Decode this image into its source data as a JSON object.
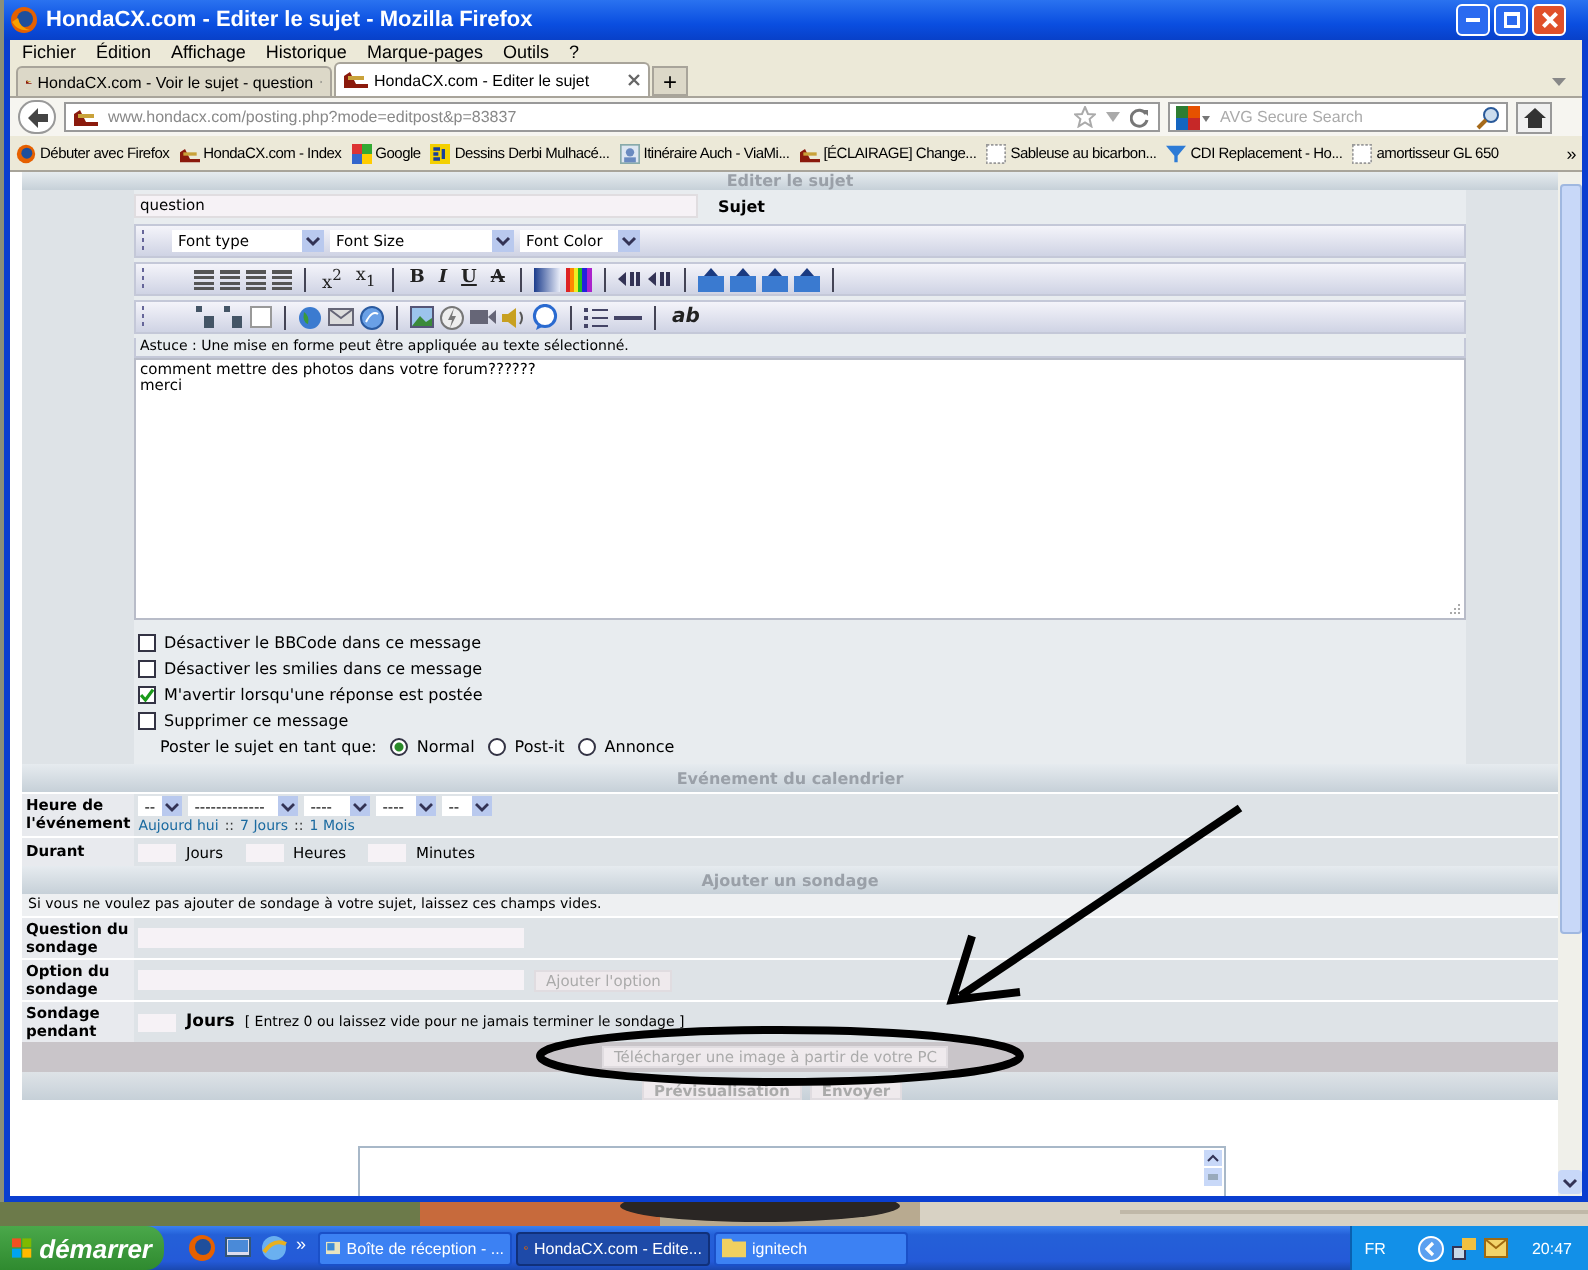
{
  "window": {
    "title": "HondaCX.com - Editer le sujet - Mozilla Firefox"
  },
  "menu": [
    "Fichier",
    "Édition",
    "Affichage",
    "Historique",
    "Marque-pages",
    "Outils",
    "?"
  ],
  "tabs": [
    {
      "label": "HondaCX.com - Voir le sujet - question",
      "selected": false
    },
    {
      "label": "HondaCX.com - Editer le sujet",
      "selected": true
    }
  ],
  "new_tab": "+",
  "address": "www.hondacx.com/posting.php?mode=editpost&p=83837",
  "search": {
    "placeholder": "AVG Secure Search"
  },
  "bookmarks": [
    "Débuter avec Firefox",
    "HondaCX.com - Index",
    "Google",
    "Dessins Derbi Mulhacé...",
    "Itinéraire Auch - ViaMi...",
    "[ÉCLAIRAGE] Change...",
    "Sableuse au bicarbon...",
    "CDI Replacement - Ho...",
    "amortisseur GL 650"
  ],
  "bookmarks_more": "»",
  "page": {
    "header": "Editer le sujet",
    "subject": {
      "value": "question",
      "label": "Sujet"
    },
    "font_selects": [
      "Font type",
      "Font Size",
      "Font Color"
    ],
    "script_buttons": [
      "x$^{2}$",
      "x$_{1}$"
    ],
    "format_buttons": [
      {
        "label": "B",
        "kind": "bold"
      },
      {
        "label": "I",
        "kind": "italic"
      },
      {
        "label": "U",
        "kind": "underline"
      },
      {
        "label": "A",
        "kind": "strike"
      }
    ],
    "spell_button": "ab",
    "hint": "Astuce : Une mise en forme peut être appliquée au texte sélectionné.",
    "message": [
      "comment mettre des photos dans votre forum??????",
      "merci"
    ],
    "options": [
      {
        "label": "Désactiver le BBCode dans ce message",
        "checked": false
      },
      {
        "label": "Désactiver les smilies dans ce message",
        "checked": false
      },
      {
        "label": "M'avertir lorsqu'une réponse est postée",
        "checked": true
      },
      {
        "label": "Supprimer ce message",
        "checked": false
      }
    ],
    "post_type": {
      "label": "Poster le sujet en tant que:",
      "choices": [
        {
          "label": "Normal",
          "selected": true
        },
        {
          "label": "Post-it",
          "selected": false
        },
        {
          "label": "Annonce",
          "selected": false
        }
      ]
    },
    "calendar": {
      "title": "Evénement du calendrier",
      "time_label": "Heure de l'événement",
      "selects": [
        "--",
        "-------------",
        "----",
        "----",
        "--"
      ],
      "shortcuts": [
        {
          "kind": "link",
          "text": "Aujourd hui"
        },
        {
          "kind": "sep",
          "text": "::"
        },
        {
          "kind": "link",
          "text": "7 Jours"
        },
        {
          "kind": "sep",
          "text": "::"
        },
        {
          "kind": "link",
          "text": "1 Mois"
        }
      ],
      "duration_label": "Durant",
      "duration_units": [
        "Jours",
        "Heures",
        "Minutes"
      ]
    },
    "poll": {
      "title": "Ajouter un sondage",
      "note": "Si vous ne voulez pas ajouter de sondage à votre sujet, laissez ces champs vides.",
      "question_label": "Question du sondage",
      "option_label": "Option du sondage",
      "add_option": "Ajouter l'option",
      "length_label": "Sondage pendant",
      "length_unit": "Jours",
      "length_hint": "[ Entrez 0 ou laissez vide pour ne jamais terminer le sondage ]"
    },
    "upload_button": "Télécharger une image à partir de votre PC",
    "actions": [
      "Prévisualisation",
      "Envoyer"
    ]
  },
  "taskbar": {
    "start": "démarrer",
    "more": "»",
    "tasks": [
      {
        "label": "Boîte de réception - ...",
        "selected": false
      },
      {
        "label": "HondaCX.com - Edite...",
        "selected": true
      },
      {
        "label": "ignitech",
        "selected": false
      }
    ],
    "language": "FR",
    "clock": "20:47"
  }
}
